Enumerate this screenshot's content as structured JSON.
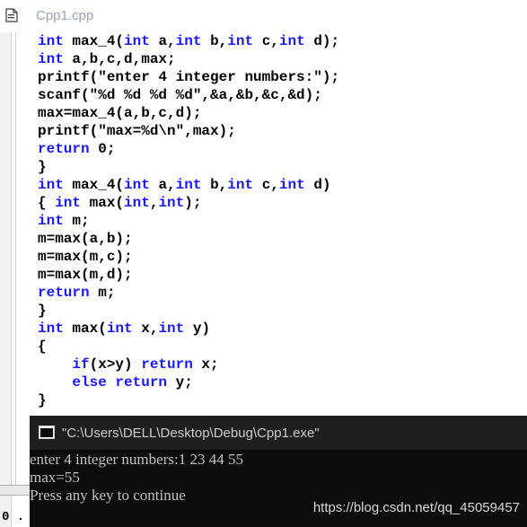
{
  "editor": {
    "file_title": "Cpp1.cpp",
    "lines": [
      [
        {
          "t": "int",
          "k": 1
        },
        {
          "t": " max_4("
        },
        {
          "t": "int",
          "k": 1
        },
        {
          "t": " a,"
        },
        {
          "t": "int",
          "k": 1
        },
        {
          "t": " b,"
        },
        {
          "t": "int",
          "k": 1
        },
        {
          "t": " c,"
        },
        {
          "t": "int",
          "k": 1
        },
        {
          "t": " d);"
        }
      ],
      [
        {
          "t": "int",
          "k": 1
        },
        {
          "t": " a,b,c,d,max;"
        }
      ],
      [
        {
          "t": "printf(\"enter 4 integer numbers:\");"
        }
      ],
      [
        {
          "t": "scanf(\"%d %d %d %d\",&a,&b,&c,&d);"
        }
      ],
      [
        {
          "t": "max=max_4(a,b,c,d);"
        }
      ],
      [
        {
          "t": "printf(\"max=%d\\n\",max);"
        }
      ],
      [
        {
          "t": "return",
          "k": 1
        },
        {
          "t": " 0;"
        }
      ],
      [
        {
          "t": "}"
        }
      ],
      [
        {
          "t": "int",
          "k": 1
        },
        {
          "t": " max_4("
        },
        {
          "t": "int",
          "k": 1
        },
        {
          "t": " a,"
        },
        {
          "t": "int",
          "k": 1
        },
        {
          "t": " b,"
        },
        {
          "t": "int",
          "k": 1
        },
        {
          "t": " c,"
        },
        {
          "t": "int",
          "k": 1
        },
        {
          "t": " d)"
        }
      ],
      [
        {
          "t": "{ "
        },
        {
          "t": "int",
          "k": 1
        },
        {
          "t": " max("
        },
        {
          "t": "int",
          "k": 1
        },
        {
          "t": ","
        },
        {
          "t": "int",
          "k": 1
        },
        {
          "t": ");"
        }
      ],
      [
        {
          "t": "int",
          "k": 1
        },
        {
          "t": " m;"
        }
      ],
      [
        {
          "t": "m=max(a,b);"
        }
      ],
      [
        {
          "t": "m=max(m,c);"
        }
      ],
      [
        {
          "t": "m=max(m,d);"
        }
      ],
      [
        {
          "t": "return",
          "k": 1
        },
        {
          "t": " m;"
        }
      ],
      [
        {
          "t": "}"
        }
      ],
      [
        {
          "t": "int",
          "k": 1
        },
        {
          "t": " max("
        },
        {
          "t": "int",
          "k": 1
        },
        {
          "t": " x,"
        },
        {
          "t": "int",
          "k": 1
        },
        {
          "t": " y)"
        }
      ],
      [
        {
          "t": "{"
        }
      ],
      [
        {
          "t": "    "
        },
        {
          "t": "if",
          "k": 1
        },
        {
          "t": "(x>y) "
        },
        {
          "t": "return",
          "k": 1
        },
        {
          "t": " x;"
        }
      ],
      [
        {
          "t": "    "
        },
        {
          "t": "else",
          "k": 1
        },
        {
          "t": " "
        },
        {
          "t": "return",
          "k": 1
        },
        {
          "t": " y;"
        }
      ],
      [
        {
          "t": "}"
        }
      ]
    ]
  },
  "console": {
    "title": "\"C:\\Users\\DELL\\Desktop\\Debug\\Cpp1.exe\"",
    "output": [
      "enter 4 integer numbers:1 23 44 55",
      "max=55",
      "Press any key to continue"
    ],
    "watermark": "https://blog.csdn.net/qq_45059457"
  },
  "colors": {
    "keyword": "#1a1aff",
    "console_bg": "#0c0c0c",
    "console_text": "#c0c0c0"
  },
  "background_window": {
    "fragment": "0 ."
  }
}
